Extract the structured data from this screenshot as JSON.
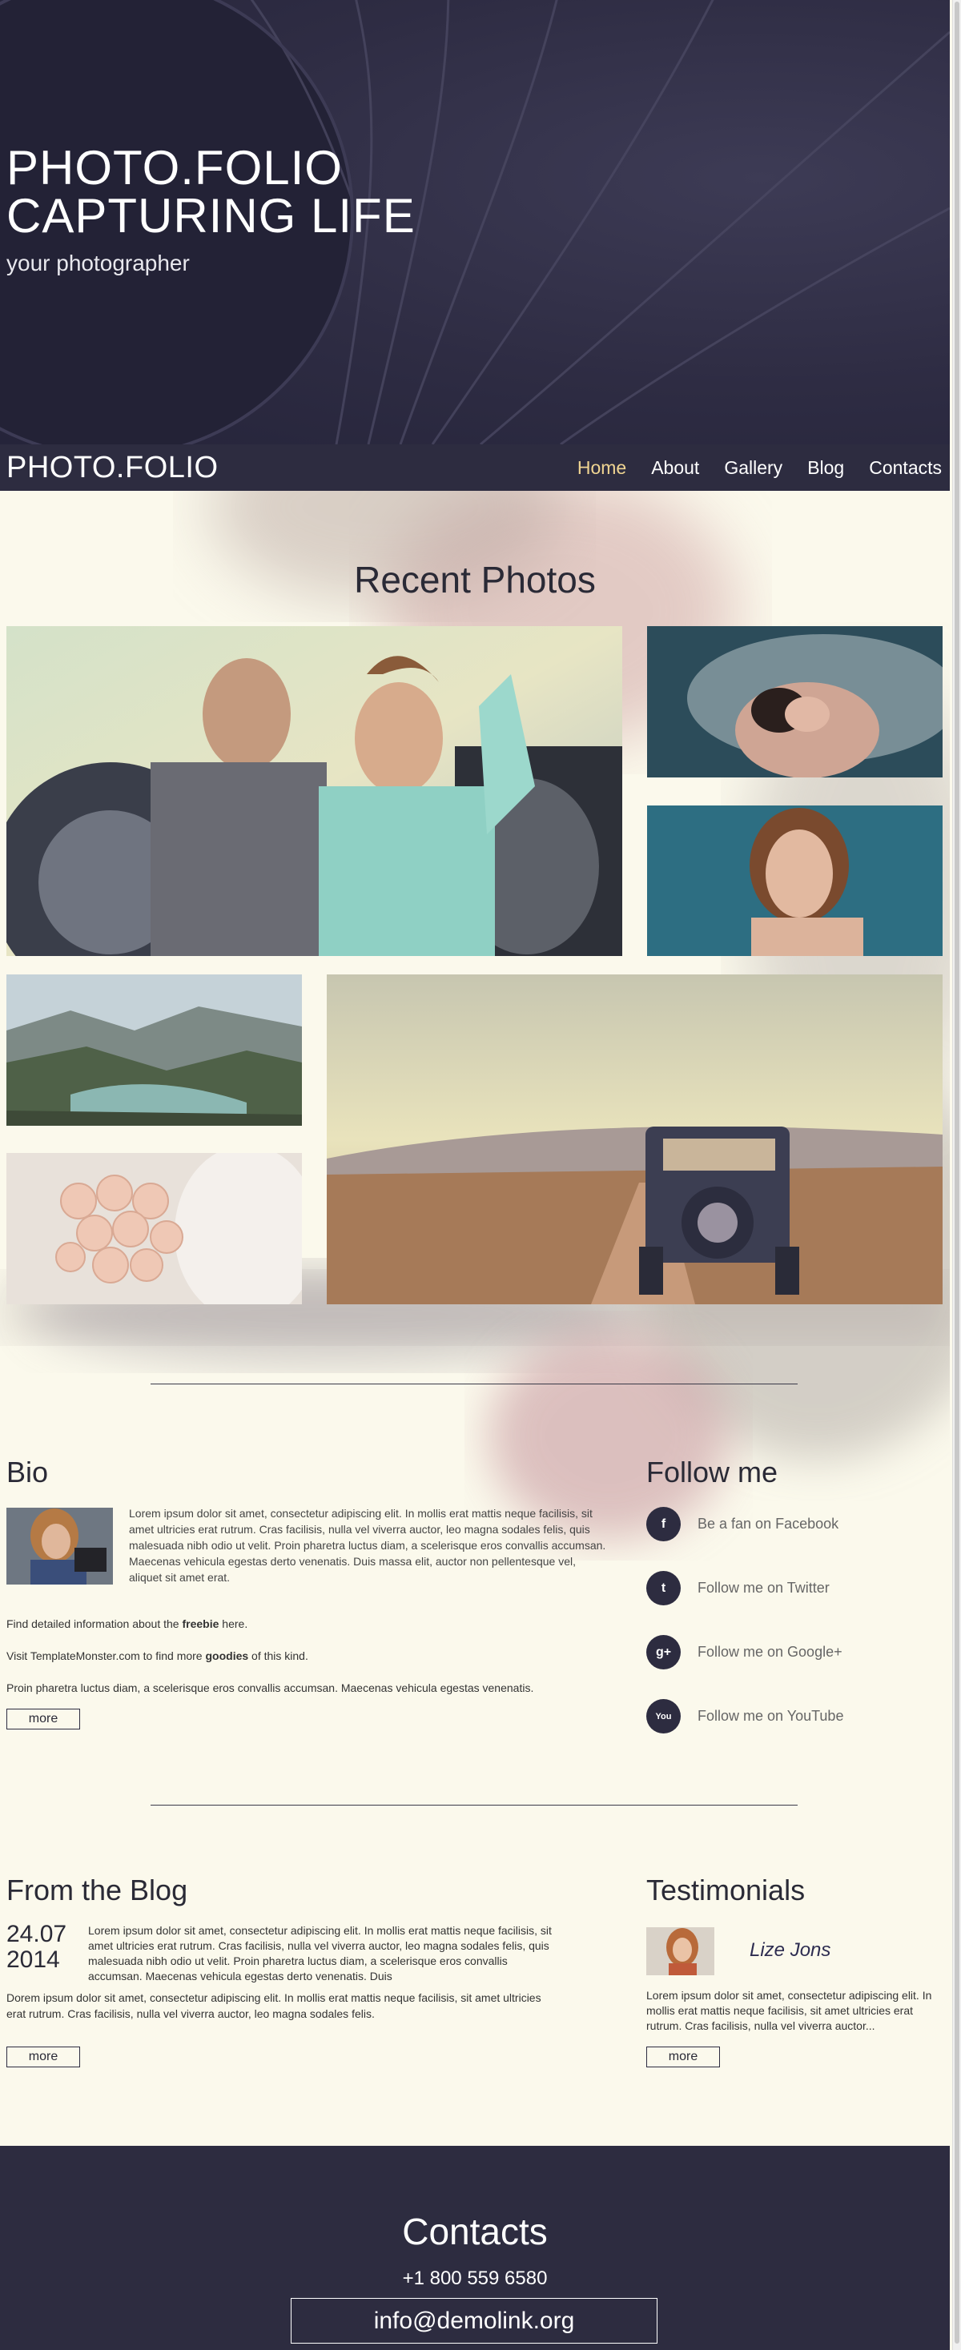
{
  "hero": {
    "title_line1": "PHOTO.FOLIO",
    "title_line2": "CAPTURING LIFE",
    "subtitle": "your photographer"
  },
  "nav": {
    "logo": "PHOTO.FOLIO",
    "items": [
      {
        "label": "Home",
        "active": true
      },
      {
        "label": "About",
        "active": false
      },
      {
        "label": "Gallery",
        "active": false
      },
      {
        "label": "Blog",
        "active": false
      },
      {
        "label": "Contacts",
        "active": false
      }
    ]
  },
  "recent": {
    "title": "Recent Photos",
    "photos": [
      "couple-motorcycle",
      "woman-veil",
      "woman-portrait",
      "mountain-lake",
      "rose-bouquet",
      "vintage-car"
    ]
  },
  "bio": {
    "title": "Bio",
    "lead": "Lorem ipsum dolor sit amet, consectetur adipiscing elit. In mollis erat mattis neque facilisis, sit amet ultricies erat rutrum. Cras facilisis, nulla vel viverra auctor, leo magna sodales felis, quis malesuada nibh odio ut velit. Proin pharetra luctus diam, a scelerisque eros convallis accumsan. Maecenas vehicula egestas derto venenatis. Duis massa elit, auctor non pellentesque vel, aliquet sit amet erat.",
    "line1_a": "Find detailed information about the ",
    "line1_b": "freebie",
    "line1_c": " here.",
    "line2_a": "Visit TemplateMonster.com to find more ",
    "line2_b": "goodies",
    "line2_c": " of this kind.",
    "line3": "Proin pharetra luctus diam, a scelerisque eros convallis accumsan. Maecenas vehicula egestas venenatis.",
    "more": "more"
  },
  "follow": {
    "title": "Follow me",
    "items": [
      {
        "icon": "facebook-icon",
        "glyph": "f",
        "label": "Be a fan on Facebook"
      },
      {
        "icon": "twitter-icon",
        "glyph": "t",
        "label": "Follow me on Twitter"
      },
      {
        "icon": "google-plus-icon",
        "glyph": "g+",
        "label": "Follow me on Google+"
      },
      {
        "icon": "youtube-icon",
        "glyph": "You",
        "label": "Follow me on YouTube"
      }
    ]
  },
  "blog": {
    "title": "From the Blog",
    "date_day": "24.07",
    "date_year": "2014",
    "lead": "Lorem ipsum dolor sit amet, consectetur adipiscing elit. In mollis erat mattis neque facilisis, sit amet ultricies erat rutrum. Cras facilisis, nulla vel viverra auctor, leo magna sodales felis, quis malesuada nibh odio ut velit. Proin pharetra luctus diam, a scelerisque eros convallis accumsan. Maecenas vehicula egestas derto venenatis. Duis",
    "text": "Dorem ipsum dolor sit amet, consectetur adipiscing elit. In mollis erat mattis neque facilisis, sit amet ultricies erat rutrum. Cras facilisis, nulla vel viverra auctor, leo magna sodales felis.",
    "more": "more"
  },
  "testimonials": {
    "title": "Testimonials",
    "name": "Lize Jons",
    "text": "Lorem ipsum dolor sit amet, consectetur adipiscing elit. In mollis erat mattis neque facilisis, sit amet ultricies erat rutrum. Cras facilisis, nulla vel viverra auctor...",
    "more": "more"
  },
  "footer": {
    "title": "Contacts",
    "phone": "+1 800 559 6580",
    "email": "info@demolink.org"
  },
  "colors": {
    "dark": "#2d2c40",
    "cream": "#fbf9ec",
    "accent": "#f0d592"
  }
}
